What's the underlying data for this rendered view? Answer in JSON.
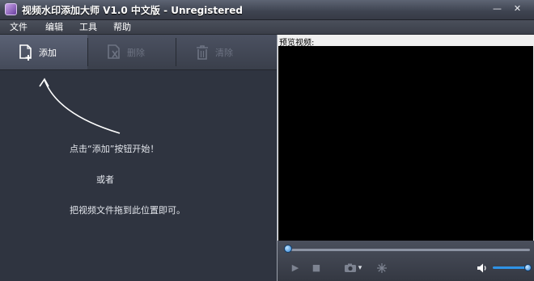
{
  "window": {
    "title": "视频水印添加大师 V1.0 中文版 - Unregistered",
    "minimize_glyph": "—",
    "close_glyph": "✕"
  },
  "menu": [
    "文件",
    "编辑",
    "工具",
    "帮助"
  ],
  "toolbar": {
    "add_label": "添加",
    "delete_label": "删除",
    "clear_label": "清除"
  },
  "hints": {
    "line1": "点击“添加”按钮开始！",
    "line2": "或者",
    "line3": "把视频文件拖到此位置即可。"
  },
  "preview": {
    "label": "预览视频:",
    "seek_position": 0,
    "volume_level": 1.0
  },
  "controls": {
    "play_glyph": "▶",
    "stop_glyph": "■",
    "snapshot_glyph": "▾"
  },
  "colors": {
    "panel_bg": "#2f3440",
    "toolbar_bg": "#444a59",
    "accent": "#2f93e6"
  }
}
